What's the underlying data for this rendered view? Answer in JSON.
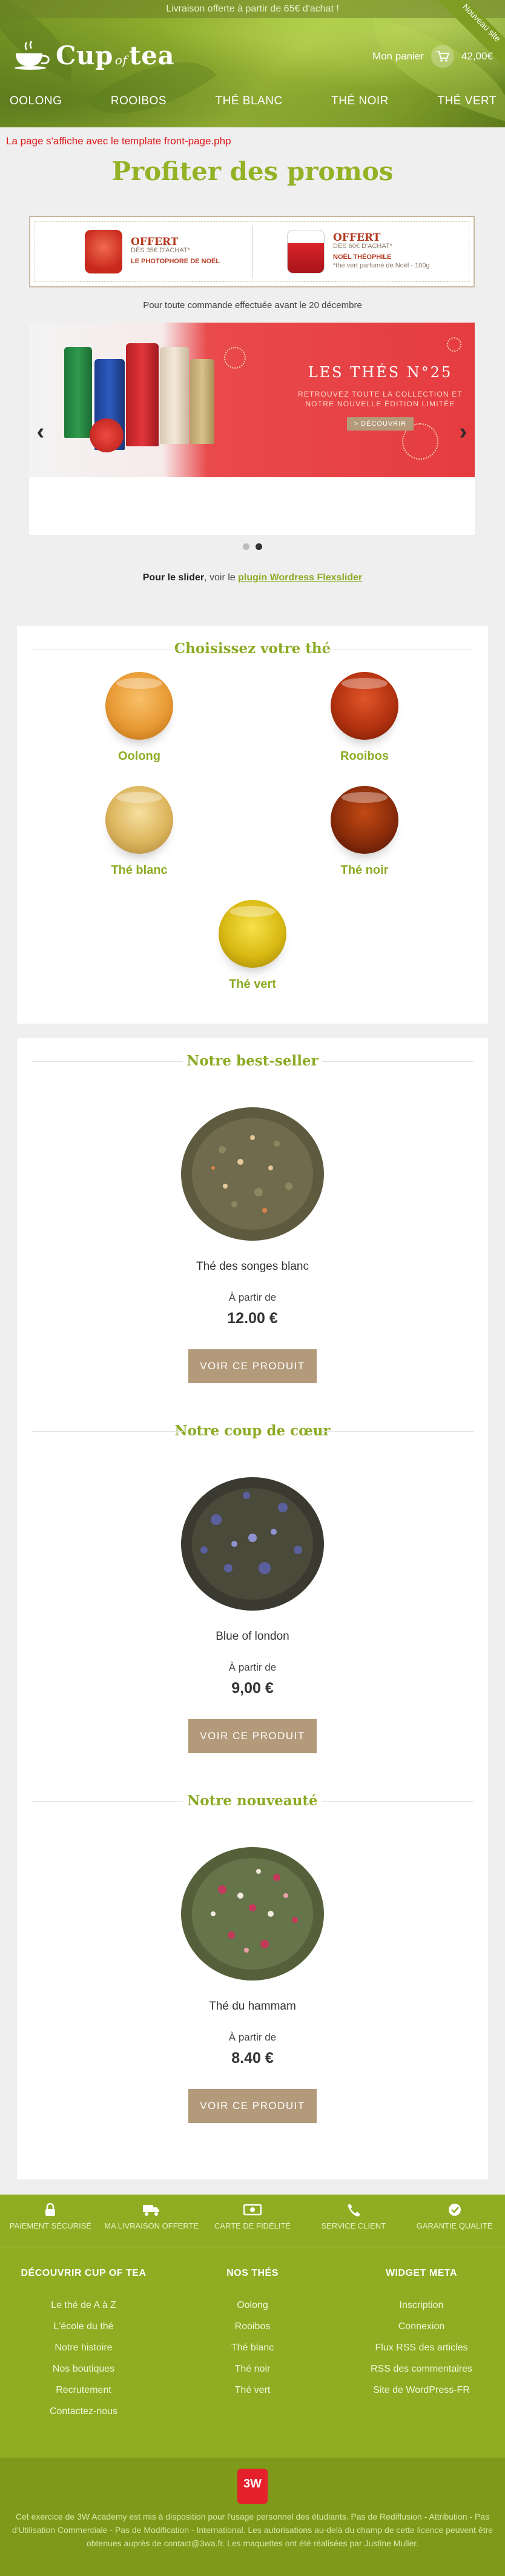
{
  "header": {
    "top_banner": "Livraison offerte à partir de 65€ d'achat !",
    "corner_badge": "Nouveau site",
    "logo": {
      "word1": "Cup",
      "word2": "of",
      "word3": "tea"
    },
    "cart": {
      "label": "Mon panier",
      "amount": "42,00€"
    },
    "nav": [
      "OOLONG",
      "ROOIBOS",
      "THÉ BLANC",
      "THÉ NOIR",
      "THÉ VERT"
    ]
  },
  "main": {
    "template_notice": "La page s'affiche avec le template front-page.php",
    "promo_title": "Profiter des promos",
    "promo_offers": [
      {
        "label": "OFFERT",
        "condition": "DÈS 35€ D'ACHAT*",
        "product": "LE PHOTOPHORE DE NOËL"
      },
      {
        "label": "OFFERT",
        "condition": "DÈS 60€ D'ACHAT*",
        "product": "NOËL THÉOPHILE",
        "note": "*thé vert parfumé de Noël - 100g"
      }
    ],
    "promo_note": "Pour toute commande effectuée avant le 20 décembre",
    "slide": {
      "heading": "LES THÉS N°25",
      "sub": "RETROUVEZ TOUTE LA COLLECTION ET NOTRE NOUVELLE ÉDITION LIMITÉE",
      "button": "> DÉCOUVRIR"
    },
    "slider_note": {
      "part1": "Pour le slider",
      "part2": ", voir le ",
      "link": "plugin Wordress Flexslider"
    }
  },
  "tea_chooser": {
    "title": "Choisissez votre thé",
    "items": [
      {
        "label": "Oolong",
        "color": "#e89a34"
      },
      {
        "label": "Rooibos",
        "color": "#b3320f"
      },
      {
        "label": "Thé blanc",
        "color": "#ddb55d"
      },
      {
        "label": "Thé noir",
        "color": "#8a2c0a"
      },
      {
        "label": "Thé vert",
        "color": "#d9b912"
      }
    ]
  },
  "products": [
    {
      "section": "Notre best-seller",
      "name": "Thé des songes blanc",
      "from": "À partir de",
      "price": "12.00 €",
      "button": "VOIR CE PRODUIT"
    },
    {
      "section": "Notre coup de cœur",
      "name": "Blue of london",
      "from": "À partir de",
      "price": "9,00 €",
      "button": "VOIR CE PRODUIT"
    },
    {
      "section": "Notre nouveauté",
      "name": "Thé du hammam",
      "from": "À partir de",
      "price": "8.40 €",
      "button": "VOIR CE PRODUIT"
    }
  ],
  "footer": {
    "features": [
      {
        "icon": "lock-icon",
        "label": "PAIEMENT SÉCURISÉ"
      },
      {
        "icon": "truck-icon",
        "label": "MA LIVRAISON OFFERTE"
      },
      {
        "icon": "card-icon",
        "label": "CARTE DE FIDÉLITÉ"
      },
      {
        "icon": "phone-icon",
        "label": "SERVICE CLIENT"
      },
      {
        "icon": "check-icon",
        "label": "GARANTIE QUALITÉ"
      }
    ],
    "columns": [
      {
        "title": "DÉCOUVRIR CUP OF TEA",
        "links": [
          "Le thé de A à Z",
          "L'école du thé",
          "Notre histoire",
          "Nos boutiques",
          "Recrutement",
          "Contactez-nous"
        ]
      },
      {
        "title": "NOS THÉS",
        "links": [
          "Oolong",
          "Rooibos",
          "Thé blanc",
          "Thé noir",
          "Thé vert"
        ]
      },
      {
        "title": "WIDGET META",
        "links": [
          "Inscription",
          "Connexion",
          "Flux RSS des articles",
          "RSS des commentaires",
          "Site de WordPress-FR"
        ]
      }
    ],
    "badge": "3W",
    "copyright": "Cet exercice de 3W Academy est mis à disposition pour l'usage personnel des étudiants. Pas de Rediffusion - Attribution - Pas d'Utilisation Commerciale - Pas de Modification - International. Les autorisations au-delà du champ de cette licence peuvent être obtenues auprès de contact@3wa.fr. Les maquettes ont été réalisées par Justine Muller."
  }
}
